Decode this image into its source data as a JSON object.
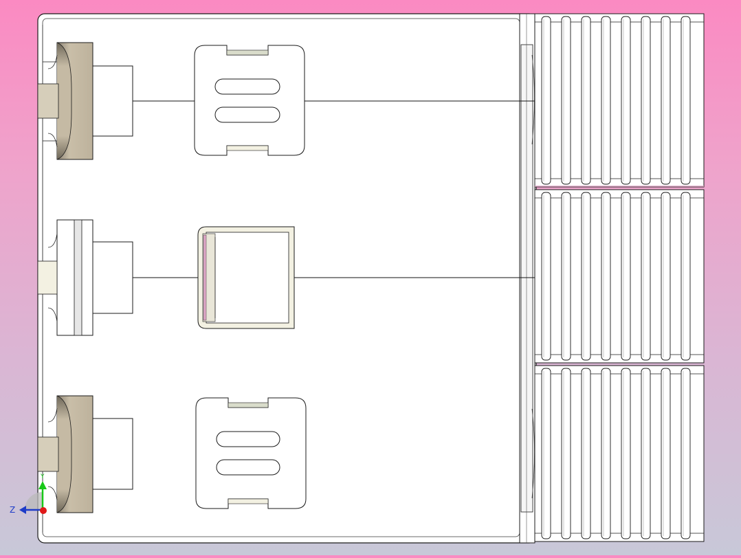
{
  "viewport": {
    "background_top": "#fb8ac2",
    "background_bottom": "#c8c8d8"
  },
  "model": {
    "body_fill": "#ffffff",
    "edge_color": "#1a1a1a",
    "beige_fill": "#c4b8a2",
    "cream_fill": "#f3f1e2",
    "accent_pink": "#e0a8c8"
  },
  "triad": {
    "z_label": "Z",
    "y_label": "Y",
    "z_color": "#1e3cc8",
    "y_color": "#18c818",
    "x_color": "#e01818"
  }
}
